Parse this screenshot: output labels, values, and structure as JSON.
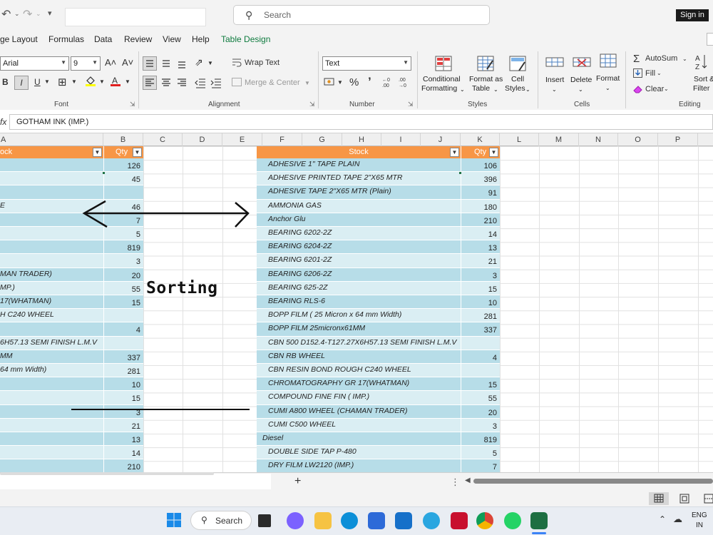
{
  "titlebar": {
    "search_placeholder": "Search",
    "signin_label": "Sign in"
  },
  "tabs": [
    "ge Layout",
    "Formulas",
    "Data",
    "Review",
    "View",
    "Help",
    "Table Design"
  ],
  "ribbon": {
    "font_name": "Arial",
    "font_size": "9",
    "grow_font": "A˄",
    "shrink_font": "A˅",
    "bold": "B",
    "italic": "I",
    "underline": "U",
    "font_group": "Font",
    "wrap_text": "Wrap Text",
    "merge_center": "Merge & Center",
    "alignment_group": "Alignment",
    "number_format": "Text",
    "percent": "%",
    "comma": "’",
    "number_group": "Number",
    "conditional_formatting": [
      "Conditional",
      "Formatting"
    ],
    "format_as_table": [
      "Format as",
      "Table"
    ],
    "cell_styles": [
      "Cell",
      "Styles"
    ],
    "styles_group": "Styles",
    "insert": "Insert",
    "delete": "Delete",
    "format": "Format",
    "cells_group": "Cells",
    "autosum": "AutoSum",
    "fill": "Fill",
    "clear": "Clear",
    "sort_filter": [
      "Sort &",
      "Filter"
    ],
    "editing_group": "Editing"
  },
  "formula_bar": {
    "fx": "fx",
    "content": "GOTHAM INK (IMP.)"
  },
  "columns": [
    "A",
    "B",
    "C",
    "D",
    "E",
    "F",
    "G",
    "H",
    "I",
    "J",
    "K",
    "L",
    "M",
    "N",
    "O",
    "P"
  ],
  "left_table": {
    "header_stock": "ock",
    "header_qty": "Qty",
    "rows": [
      {
        "stock": "",
        "qty": "126"
      },
      {
        "stock": "",
        "qty": "45"
      },
      {
        "stock": "",
        "qty": ""
      },
      {
        "stock": "E",
        "qty": "46"
      },
      {
        "stock": "",
        "qty": "7"
      },
      {
        "stock": "",
        "qty": "5"
      },
      {
        "stock": "",
        "qty": "819"
      },
      {
        "stock": "",
        "qty": "3"
      },
      {
        "stock": "MAN TRADER)",
        "qty": "20"
      },
      {
        "stock": "MP.)",
        "qty": "55"
      },
      {
        "stock": "17(WHATMAN)",
        "qty": "15"
      },
      {
        "stock": "H C240 WHEEL",
        "qty": ""
      },
      {
        "stock": "",
        "qty": "4"
      },
      {
        "stock": "6H57.13 SEMI FINISH L.M.V",
        "qty": ""
      },
      {
        "stock": "MM",
        "qty": "337"
      },
      {
        "stock": "64 mm Width)",
        "qty": "281"
      },
      {
        "stock": "",
        "qty": "10"
      },
      {
        "stock": "",
        "qty": "15"
      },
      {
        "stock": "",
        "qty": "3"
      },
      {
        "stock": "",
        "qty": "21"
      },
      {
        "stock": "",
        "qty": "13"
      },
      {
        "stock": "",
        "qty": "14"
      },
      {
        "stock": "",
        "qty": "210"
      }
    ]
  },
  "right_table": {
    "header_stock": "Stock",
    "header_qty": "Qty",
    "rows": [
      {
        "stock": "ADHESIVE 1\" TAPE PLAIN",
        "qty": "106"
      },
      {
        "stock": "ADHESIVE PRINTED TAPE 2\"X65 MTR",
        "qty": "396"
      },
      {
        "stock": "ADHESIVE TAPE 2\"X65 MTR (Plain)",
        "qty": "91"
      },
      {
        "stock": "AMMONIA GAS",
        "qty": "180"
      },
      {
        "stock": "Anchor Glu",
        "qty": "210"
      },
      {
        "stock": "BEARING  6202-2Z",
        "qty": "14"
      },
      {
        "stock": "BEARING  6204-2Z",
        "qty": "13"
      },
      {
        "stock": "BEARING 6201-2Z",
        "qty": "21"
      },
      {
        "stock": "BEARING 6206-2Z",
        "qty": "3"
      },
      {
        "stock": "BEARING 625-2Z",
        "qty": "15"
      },
      {
        "stock": "BEARING RLS-6",
        "qty": "10"
      },
      {
        "stock": "BOPP FILM ( 25 Micron x 64 mm Width)",
        "qty": "281"
      },
      {
        "stock": "BOPP FILM 25micronx61MM",
        "qty": "337"
      },
      {
        "stock": "CBN 500 D152.4-T127.27X6H57.13 SEMI FINISH L.M.V",
        "qty": ""
      },
      {
        "stock": "CBN RB WHEEL",
        "qty": "4"
      },
      {
        "stock": "CBN RESIN BOND ROUGH C240 WHEEL",
        "qty": ""
      },
      {
        "stock": "CHROMATOGRAPHY GR 17(WHATMAN)",
        "qty": "15"
      },
      {
        "stock": "COMPOUND FINE FIN ( IMP.)",
        "qty": "55"
      },
      {
        "stock": "CUMI A800 WHEEL (CHAMAN TRADER)",
        "qty": "20"
      },
      {
        "stock": "CUMI C500 WHEEL",
        "qty": "3"
      },
      {
        "stock": "Diesel",
        "qty": "819"
      },
      {
        "stock": "DOUBLE SIDE TAP P-480",
        "qty": "5"
      },
      {
        "stock": "DRY FILM LW2120 (IMP.)",
        "qty": "7"
      }
    ]
  },
  "annotation": {
    "label": "Sorting"
  },
  "sheetbar": {
    "add_sheet": "+",
    "more": "⋮"
  },
  "taskbar": {
    "search_label": "Search",
    "lang_top": "ENG",
    "lang_bottom": "IN"
  },
  "colors": {
    "header_orange": "#f79646",
    "row_dark": "#b7dde8",
    "row_light": "#daeef3",
    "accent_green": "#0f7b3f"
  }
}
